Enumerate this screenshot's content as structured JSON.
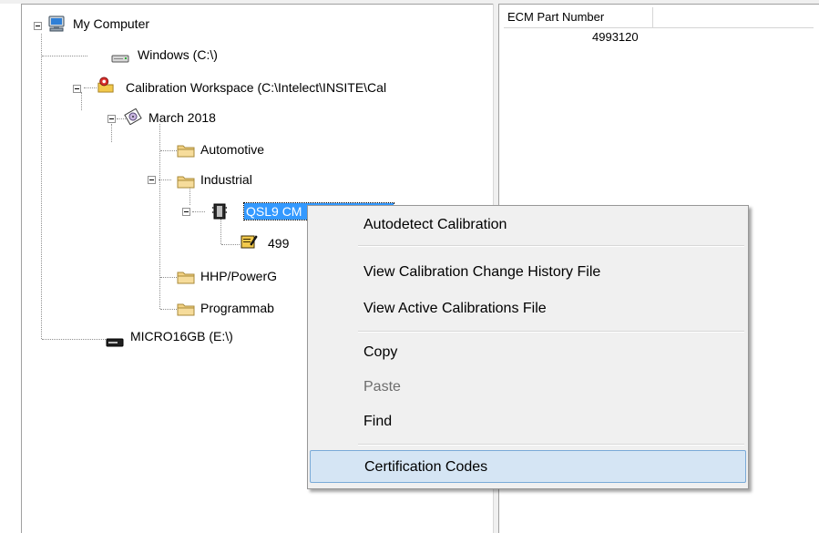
{
  "tree": {
    "nodes": [
      {
        "label": "My Computer",
        "icon": "computer-icon"
      },
      {
        "label": "Windows  (C:\\)",
        "icon": "drive-icon"
      },
      {
        "label": "Calibration Workspace  (C:\\Intelect\\INSITE\\Cal",
        "icon": "calibration-workspace-icon"
      },
      {
        "label": "March 2018",
        "icon": "calendar-disc-icon"
      },
      {
        "label": "Automotive",
        "icon": "folder-icon"
      },
      {
        "label": "Industrial",
        "icon": "folder-icon"
      },
      {
        "label": "QSL9 CM",
        "icon": "ecm-module-icon"
      },
      {
        "label": "499",
        "icon": "calibration-file-icon"
      },
      {
        "label": "HHP/PowerG",
        "icon": "folder-icon"
      },
      {
        "label": "Programmab",
        "icon": "folder-icon"
      },
      {
        "label": "MICRO16GB  (E:\\)",
        "icon": "removable-drive-icon"
      }
    ]
  },
  "list": {
    "columns": [
      "ECM Part Number",
      ""
    ],
    "rows": [
      [
        "4993120",
        ""
      ]
    ]
  },
  "context_menu": {
    "items": [
      {
        "label": "Autodetect Calibration",
        "enabled": true
      },
      {
        "label": "View Calibration Change History File",
        "enabled": true
      },
      {
        "label": "View Active Calibrations File",
        "enabled": true
      },
      {
        "label": "Copy",
        "enabled": true
      },
      {
        "label": "Paste",
        "enabled": false
      },
      {
        "label": "Find",
        "enabled": true
      },
      {
        "label": "Certification Codes",
        "enabled": true,
        "highlighted": true
      }
    ]
  },
  "colors": {
    "selection": "#3399ff",
    "menu_background": "#f0f0f0",
    "menu_highlight": "#d5e5f4",
    "menu_highlight_border": "#7aaad8",
    "folder": "#f2d183"
  }
}
